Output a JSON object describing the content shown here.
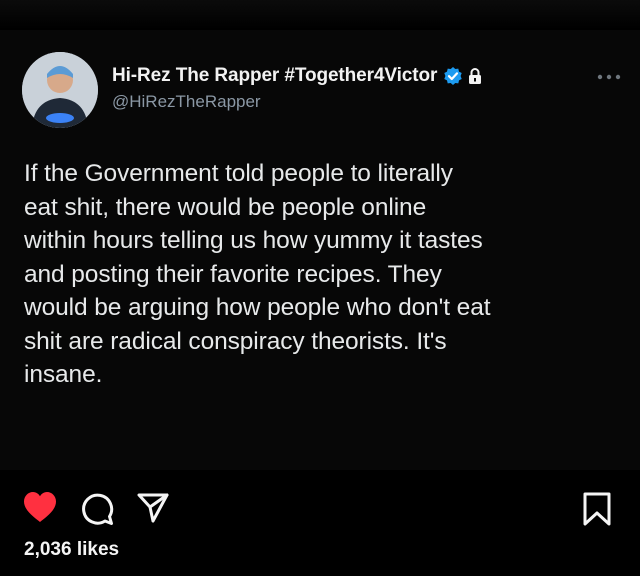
{
  "post": {
    "author": {
      "display_name": "Hi-Rez The Rapper #Together4Victor",
      "handle": "@HiRezTheRapper",
      "verified": true,
      "protected": true,
      "avatar_icon": "user-avatar"
    },
    "text": "If the Government told people to literally\neat shit, there would be people online\nwithin hours telling us how yummy it tastes\nand posting their favorite recipes. They\nwould be arguing how people who don't eat\nshit are radical conspiracy theorists. It's\ninsane.",
    "more_icon": "more-horizontal-icon"
  },
  "actions": {
    "like": {
      "icon": "heart-icon",
      "active": true,
      "color": "#ff3040"
    },
    "comment": {
      "icon": "comment-icon"
    },
    "share": {
      "icon": "send-icon"
    },
    "save": {
      "icon": "bookmark-icon"
    }
  },
  "likes_label": "2,036 likes",
  "colors": {
    "background": "#000000",
    "verified_blue": "#1d9bf0",
    "like_red": "#ff3040",
    "handle_gray": "#8b98a5"
  }
}
